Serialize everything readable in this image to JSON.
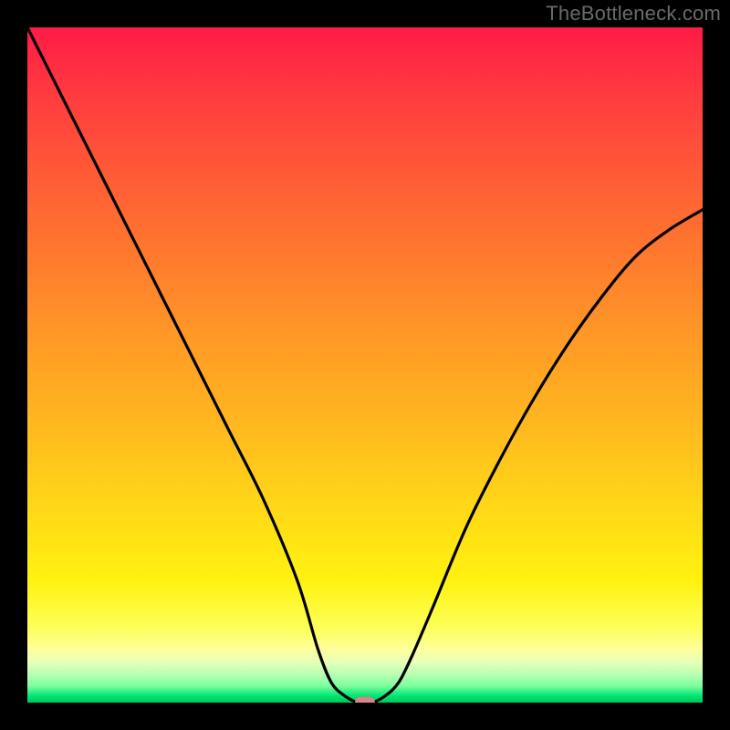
{
  "watermark": "TheBottleneck.com",
  "colors": {
    "gradient_top": "#ff1a46",
    "gradient_mid": "#ffd518",
    "gradient_bottom": "#00c853",
    "curve": "#000000",
    "marker": "#d6858b",
    "frame": "#000000"
  },
  "chart_data": {
    "type": "line",
    "title": "",
    "xlabel": "",
    "ylabel": "",
    "xlim": [
      0,
      100
    ],
    "ylim": [
      0,
      100
    ],
    "grid": false,
    "legend": false,
    "x": [
      0,
      5,
      10,
      15,
      20,
      25,
      30,
      35,
      40,
      43,
      45,
      47,
      49,
      51,
      53,
      55,
      57,
      60,
      65,
      70,
      75,
      80,
      85,
      90,
      95,
      100
    ],
    "y": [
      100,
      90,
      80,
      70,
      60,
      50,
      40,
      30,
      18,
      8,
      3,
      1,
      0,
      0,
      1,
      3,
      7,
      14,
      26,
      36,
      45,
      53,
      60,
      66,
      70,
      73
    ],
    "series": [
      {
        "name": "bottleneck-curve",
        "x_key": "x",
        "y_key": "y"
      }
    ],
    "marker": {
      "x": 50,
      "y": 0,
      "w": 2.8,
      "h": 1.6
    }
  }
}
